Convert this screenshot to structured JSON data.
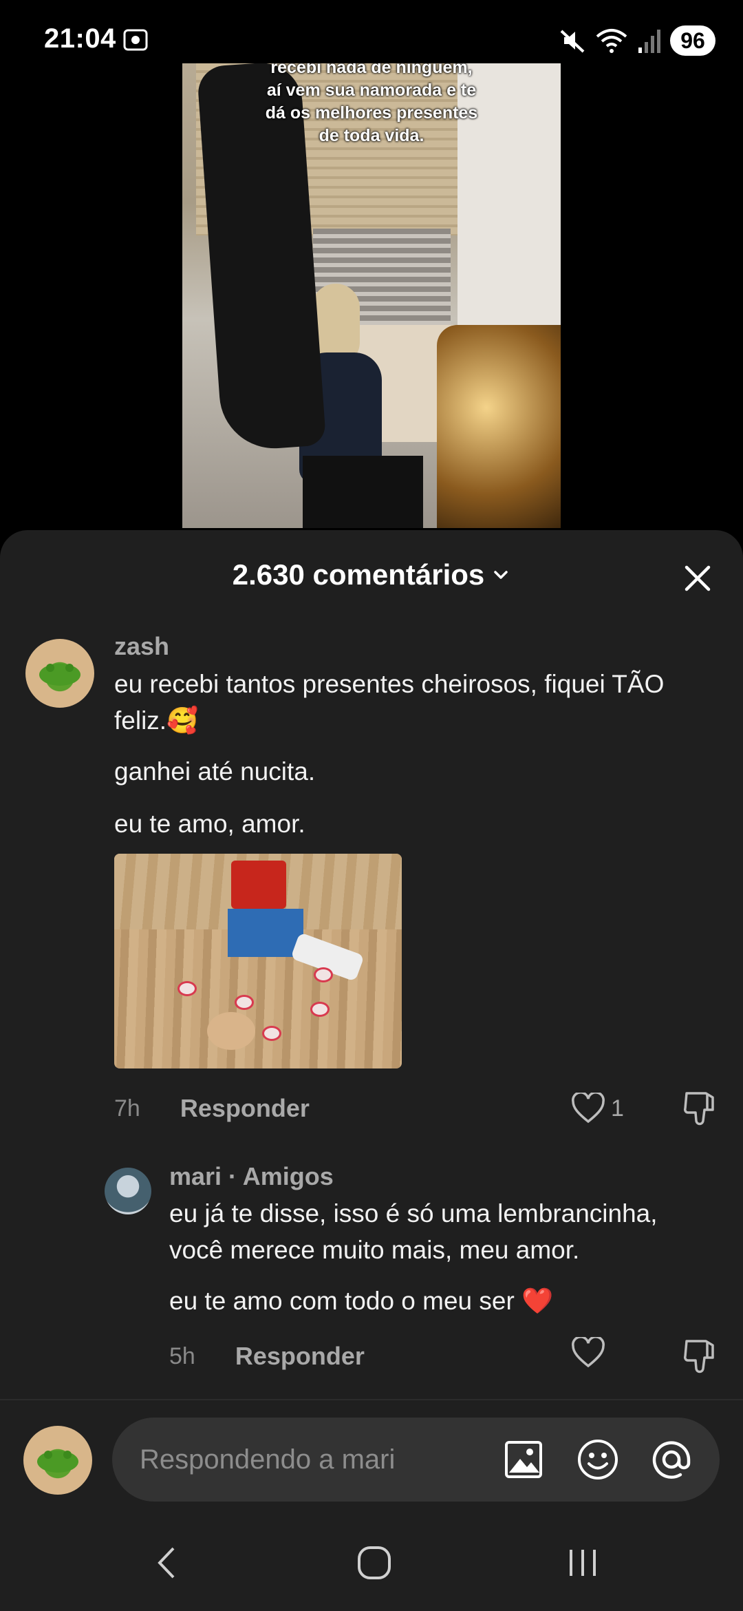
{
  "status_bar": {
    "time": "21:04",
    "battery": "96",
    "icons": [
      "screenshot-icon",
      "mute-icon",
      "wifi-icon",
      "signal-icon"
    ]
  },
  "video": {
    "caption": "recebi nada de ninguém,\naí vem sua namorada e te\ndá os melhores presentes\nde toda vida."
  },
  "comments_sheet": {
    "title": "2.630 comentários",
    "close_icon": "close-icon"
  },
  "comment_1": {
    "username": "zash",
    "text_1": "eu recebi tantos presentes cheirosos, fiquei TÃO feliz.🥰",
    "text_2": "ganhei até nucita.",
    "text_3": "eu te amo, amor.",
    "time": "7h",
    "reply_label": "Responder",
    "likes": "1"
  },
  "reply_1": {
    "username": "mari · Amigos",
    "text_1": "eu já te disse, isso é só uma lembrancinha, você merece muito mais, meu amor.",
    "text_2": "eu te amo com todo o meu ser ❤️",
    "time": "5h",
    "reply_label": "Responder"
  },
  "input": {
    "placeholder": "Respondendo a mari",
    "icons": [
      "image-icon",
      "emoji-icon",
      "mention-icon"
    ]
  },
  "colors": {
    "sheet_bg": "#1f1f1f",
    "input_bg": "#333333",
    "heart_red": "#e0313d"
  }
}
